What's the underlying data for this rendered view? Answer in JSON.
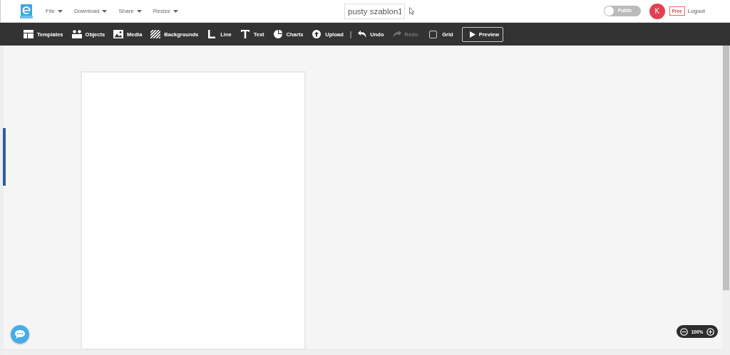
{
  "header": {
    "menus": [
      {
        "label": "File"
      },
      {
        "label": "Download"
      },
      {
        "label": "Share"
      },
      {
        "label": "Resize"
      }
    ],
    "document_title": "pusty szablon1",
    "public_toggle": {
      "label": "Public",
      "on": false
    },
    "avatar": "K",
    "plan_badge": "Free",
    "logout": "Logout"
  },
  "toolbar": {
    "items": [
      {
        "kind": "tool",
        "label": "Templates"
      },
      {
        "kind": "tool",
        "label": "Objects"
      },
      {
        "kind": "tool",
        "label": "Media"
      },
      {
        "kind": "tool",
        "label": "Backgrounds"
      },
      {
        "kind": "tool",
        "label": "Line"
      },
      {
        "kind": "tool",
        "label": "Text"
      },
      {
        "kind": "tool",
        "label": "Charts"
      },
      {
        "kind": "tool",
        "label": "Upload"
      },
      {
        "kind": "separator",
        "label": "|"
      },
      {
        "kind": "history",
        "label": "Undo",
        "disabled": false
      },
      {
        "kind": "history",
        "label": "Redo",
        "disabled": true
      },
      {
        "kind": "checkbox",
        "label": "Grid",
        "checked": false
      },
      {
        "kind": "button",
        "label": "Preview"
      }
    ]
  },
  "zoom": {
    "value": "100%"
  }
}
